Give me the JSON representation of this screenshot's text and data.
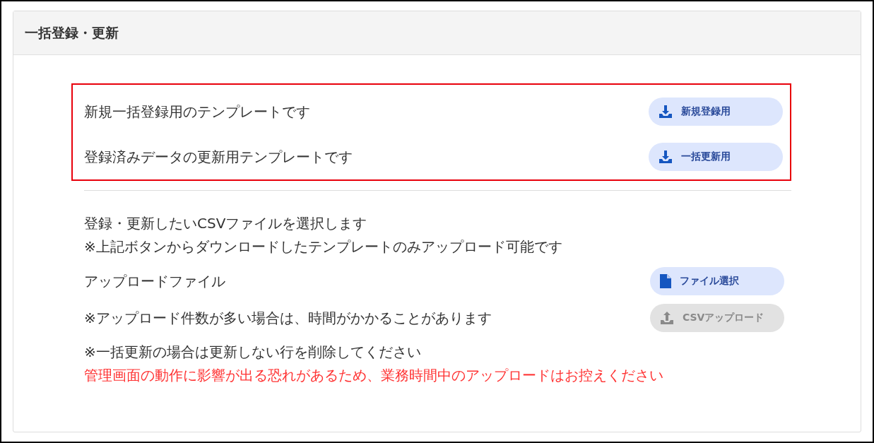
{
  "panel": {
    "title": "一括登録・更新"
  },
  "templates": [
    {
      "text": "新規一括登録用のテンプレートです",
      "button": {
        "label": "新規登録用",
        "kind": "download",
        "disabled": false
      }
    },
    {
      "text": "登録済みデータの更新用テンプレートです",
      "button": {
        "label": "一括更新用",
        "kind": "download",
        "disabled": false
      }
    }
  ],
  "upload": {
    "notes": [
      "登録・更新したいCSVファイルを選択します",
      "※上記ボタンからダウンロードしたテンプレートのみアップロード可能です"
    ],
    "rows": [
      {
        "text": "アップロードファイル",
        "button": {
          "label": "ファイル選択",
          "kind": "file",
          "disabled": false
        }
      },
      {
        "text": "※アップロード件数が多い場合は、時間がかかることがあります",
        "button": {
          "label": "CSVアップロード",
          "kind": "upload",
          "disabled": true
        }
      }
    ],
    "footer": [
      {
        "text": "※一括更新の場合は更新しない行を削除してください",
        "kind": "note"
      },
      {
        "text": "管理画面の動作に影響が出る恐れがあるため、業務時間中のアップロードはお控えください",
        "kind": "warning"
      }
    ]
  }
}
